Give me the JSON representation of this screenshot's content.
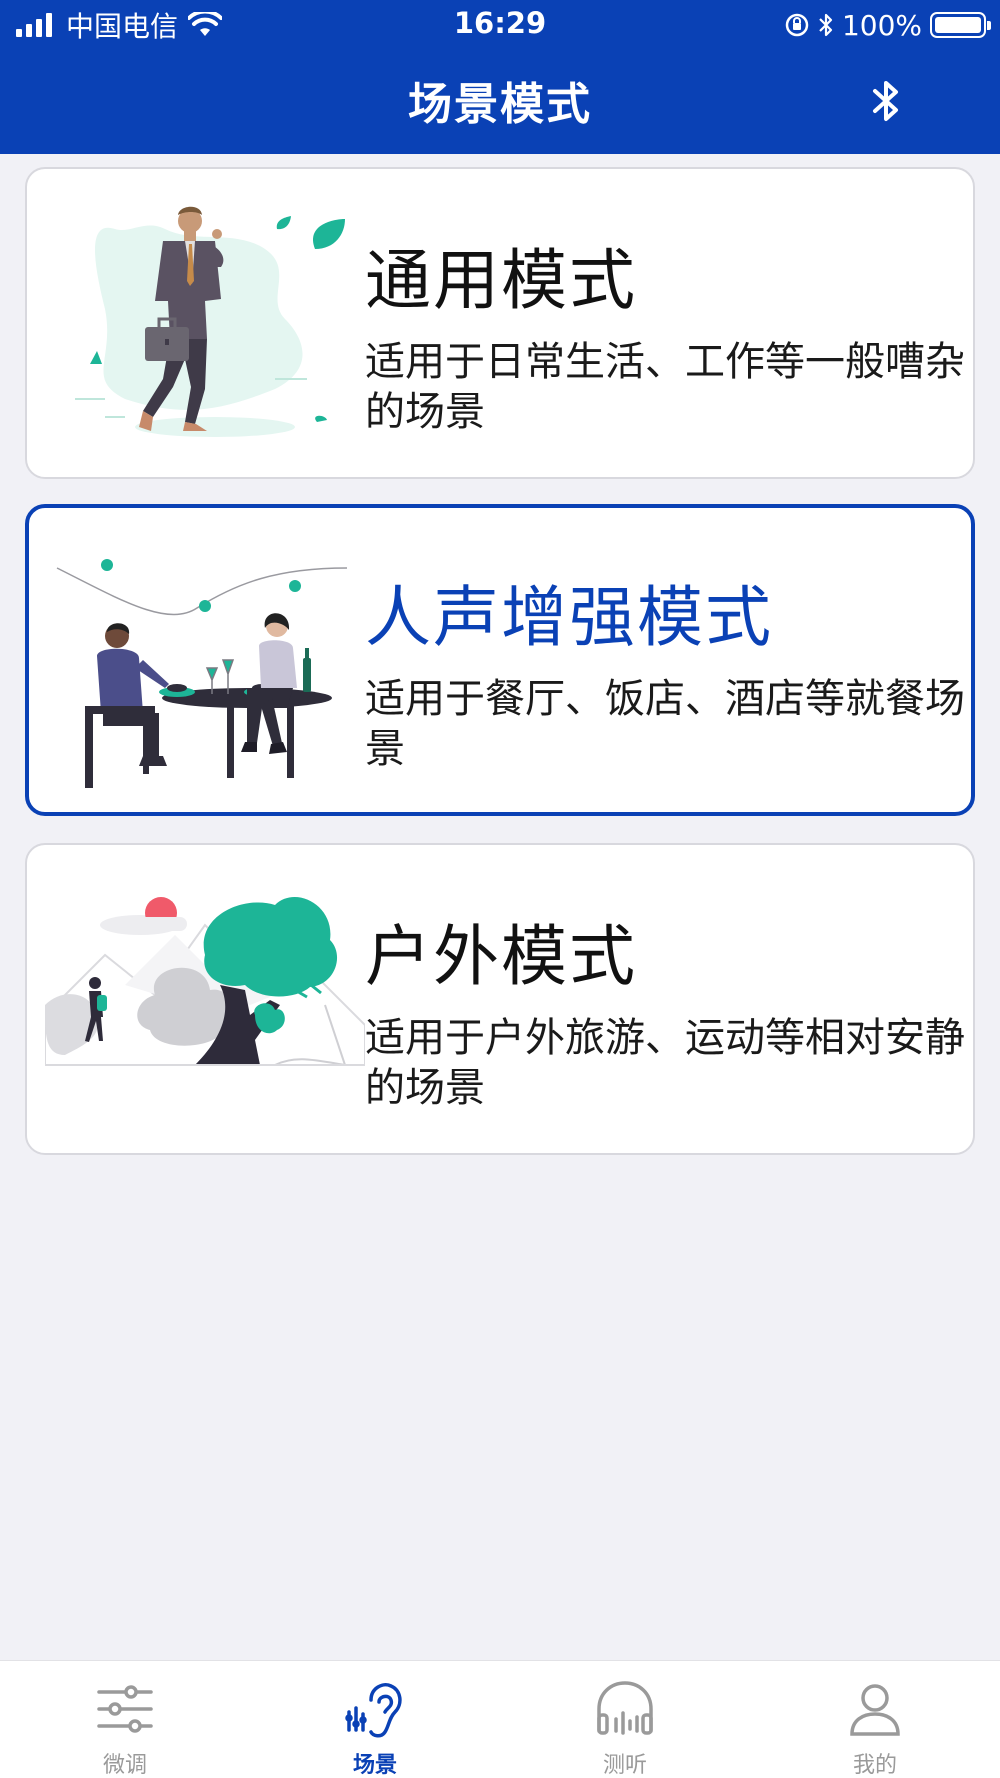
{
  "status_bar": {
    "carrier": "中国电信",
    "time": "16:29",
    "battery": "100%"
  },
  "header": {
    "title": "场景模式",
    "bluetooth_icon": "bluetooth-icon"
  },
  "colors": {
    "brand": "#0a41b5",
    "teal": "#1db597",
    "background": "#f1f1f6"
  },
  "modes": [
    {
      "title": "通用模式",
      "description": "适用于日常生活、工作等一般嘈杂的场景",
      "illustration": "business-man-illustration",
      "selected": false
    },
    {
      "title": "人声增强模式",
      "description": "适用于餐厅、饭店、酒店等就餐场景",
      "illustration": "restaurant-dinner-illustration",
      "selected": true
    },
    {
      "title": "户外模式",
      "description": "适用于户外旅游、运动等相对安静的场景",
      "illustration": "outdoor-hiking-illustration",
      "selected": false
    }
  ],
  "tabs": [
    {
      "label": "微调",
      "icon": "sliders-icon",
      "active": false
    },
    {
      "label": "场景",
      "icon": "ear-icon",
      "active": true
    },
    {
      "label": "测听",
      "icon": "headphones-icon",
      "active": false
    },
    {
      "label": "我的",
      "icon": "user-icon",
      "active": false
    }
  ]
}
